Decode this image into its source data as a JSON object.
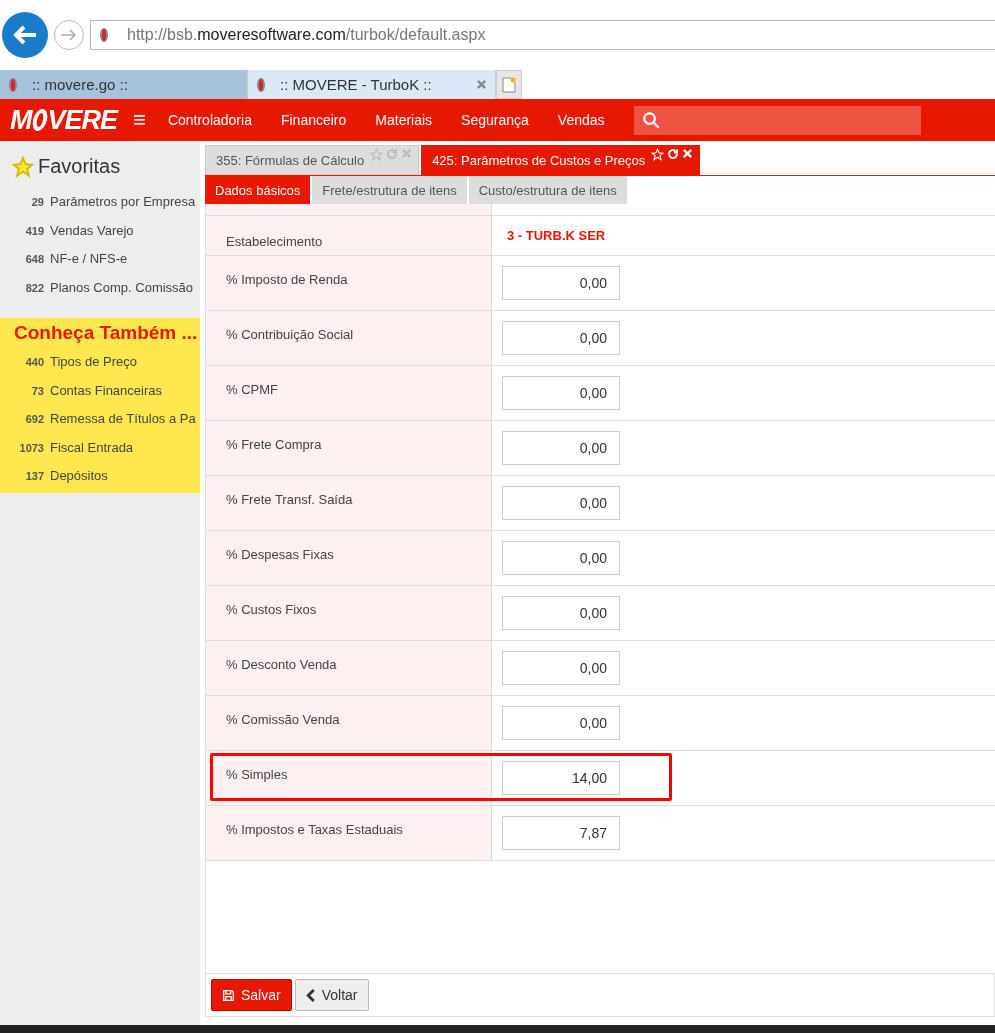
{
  "browser": {
    "url_host_prefix": "http://bsb.",
    "url_domain": "moveresoftware.com",
    "url_path": "/turbok/default.aspx",
    "tabs": [
      {
        "title": ":: movere.go ::",
        "selected": false
      },
      {
        "title": ":: MOVERE - TurboK ::",
        "selected": true
      }
    ]
  },
  "app": {
    "logo": "M",
    "logo_rest": "VERE",
    "menu_icon": "≡",
    "nav": [
      "Controladoria",
      "Financeiro",
      "Materiais",
      "Segurança",
      "Vendas"
    ]
  },
  "sidebar": {
    "favorites_title": "Favoritas",
    "favorites": [
      {
        "code": "29",
        "label": "Parâmetros por Empresa"
      },
      {
        "code": "419",
        "label": "Vendas Varejo"
      },
      {
        "code": "648",
        "label": "NF-e / NFS-e"
      },
      {
        "code": "822",
        "label": "Planos Comp. Comissão"
      }
    ],
    "discover_title": "Conheça Também ...",
    "discover": [
      {
        "code": "440",
        "label": "Tipos de Preço"
      },
      {
        "code": "73",
        "label": "Contas Financeiras"
      },
      {
        "code": "692",
        "label": "Remessa de Títulos a Pa"
      },
      {
        "code": "1073",
        "label": "Fiscal Entrada"
      },
      {
        "code": "137",
        "label": "Depósitos"
      }
    ]
  },
  "doc_tabs": [
    {
      "title": "355: Fórmulas de Cálculo",
      "selected": false
    },
    {
      "title": "425: Parâmetros de Custos e Preços",
      "selected": true
    }
  ],
  "sub_tabs": [
    {
      "label": "Dados básicos",
      "selected": true
    },
    {
      "label": "Frete/estrutura de itens",
      "selected": false
    },
    {
      "label": "Custo/estrutura de itens",
      "selected": false
    }
  ],
  "form_rows": [
    {
      "kind": "text",
      "label": "Estabelecimento",
      "value": "3 - TURB.K SER",
      "highlighted": false
    },
    {
      "kind": "input",
      "label": "% Imposto de Renda",
      "value": "0,00",
      "highlighted": false
    },
    {
      "kind": "input",
      "label": "% Contribuição Social",
      "value": "0,00",
      "highlighted": false
    },
    {
      "kind": "input",
      "label": "% CPMF",
      "value": "0,00",
      "highlighted": false
    },
    {
      "kind": "input",
      "label": "% Frete Compra",
      "value": "0,00",
      "highlighted": false
    },
    {
      "kind": "input",
      "label": "% Frete Transf. Saída",
      "value": "0,00",
      "highlighted": false
    },
    {
      "kind": "input",
      "label": "% Despesas Fixas",
      "value": "0,00",
      "highlighted": false
    },
    {
      "kind": "input",
      "label": "% Custos Fixos",
      "value": "0,00",
      "highlighted": false
    },
    {
      "kind": "input",
      "label": "% Desconto Venda",
      "value": "0,00",
      "highlighted": false
    },
    {
      "kind": "input",
      "label": "% Comissão Venda",
      "value": "0,00",
      "highlighted": false
    },
    {
      "kind": "input",
      "label": "% Simples",
      "value": "14,00",
      "highlighted": true
    },
    {
      "kind": "input",
      "label": "% Impostos e Taxas Estaduais",
      "value": "7,87",
      "highlighted": false
    }
  ],
  "buttons": [
    {
      "kind": "primary",
      "label": "Salvar"
    },
    {
      "kind": "secondary",
      "label": "Voltar"
    }
  ]
}
